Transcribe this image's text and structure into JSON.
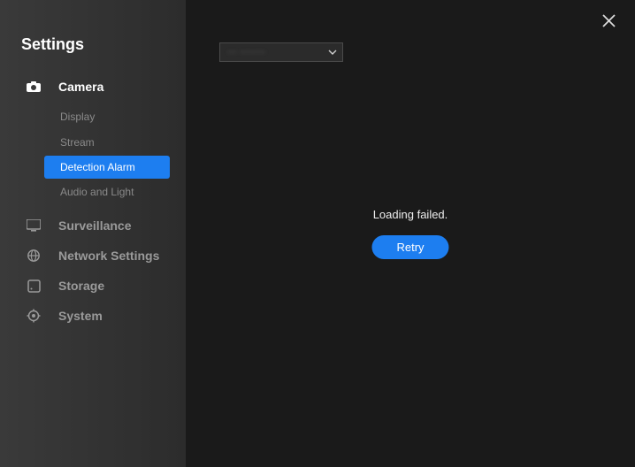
{
  "sidebar": {
    "title": "Settings",
    "sections": [
      {
        "key": "camera",
        "label": "Camera",
        "active": true,
        "sub": [
          {
            "label": "Display"
          },
          {
            "label": "Stream"
          },
          {
            "label": "Detection Alarm",
            "selected": true
          },
          {
            "label": "Audio and Light"
          }
        ]
      },
      {
        "key": "surveillance",
        "label": "Surveillance"
      },
      {
        "key": "network",
        "label": "Network Settings"
      },
      {
        "key": "storage",
        "label": "Storage"
      },
      {
        "key": "system",
        "label": "System"
      }
    ]
  },
  "topbar": {
    "dropdown_selected": "··· ········"
  },
  "main": {
    "loading_failed_text": "Loading failed.",
    "retry_label": "Retry"
  },
  "colors": {
    "accent": "#1d7ef0"
  }
}
